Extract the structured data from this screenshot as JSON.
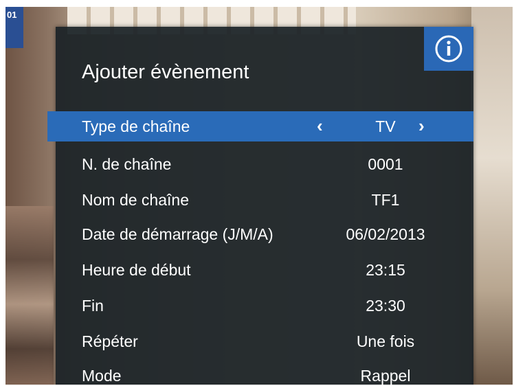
{
  "corner": {
    "channel_label": "01"
  },
  "menu": {
    "title": "Ajouter évènement",
    "info_icon": "info-icon",
    "rows": [
      {
        "label": "Type de chaîne",
        "value": "TV",
        "selected": true,
        "arrow_left": "‹",
        "arrow_right": "›"
      },
      {
        "label": "N. de chaîne",
        "value": "0001"
      },
      {
        "label": "Nom de chaîne",
        "value": "TF1"
      },
      {
        "label": "Date de démarrage (J/M/A)",
        "value": "06/02/2013"
      },
      {
        "label": "Heure de début",
        "value": "23:15"
      },
      {
        "label": "Fin",
        "value": "23:30"
      },
      {
        "label": "Répéter",
        "value": "Une fois"
      },
      {
        "label": "Mode",
        "value": "Rappel"
      }
    ]
  },
  "colors": {
    "panel": "#1a2126",
    "accent": "#2a6bb8",
    "text": "#ffffff"
  }
}
